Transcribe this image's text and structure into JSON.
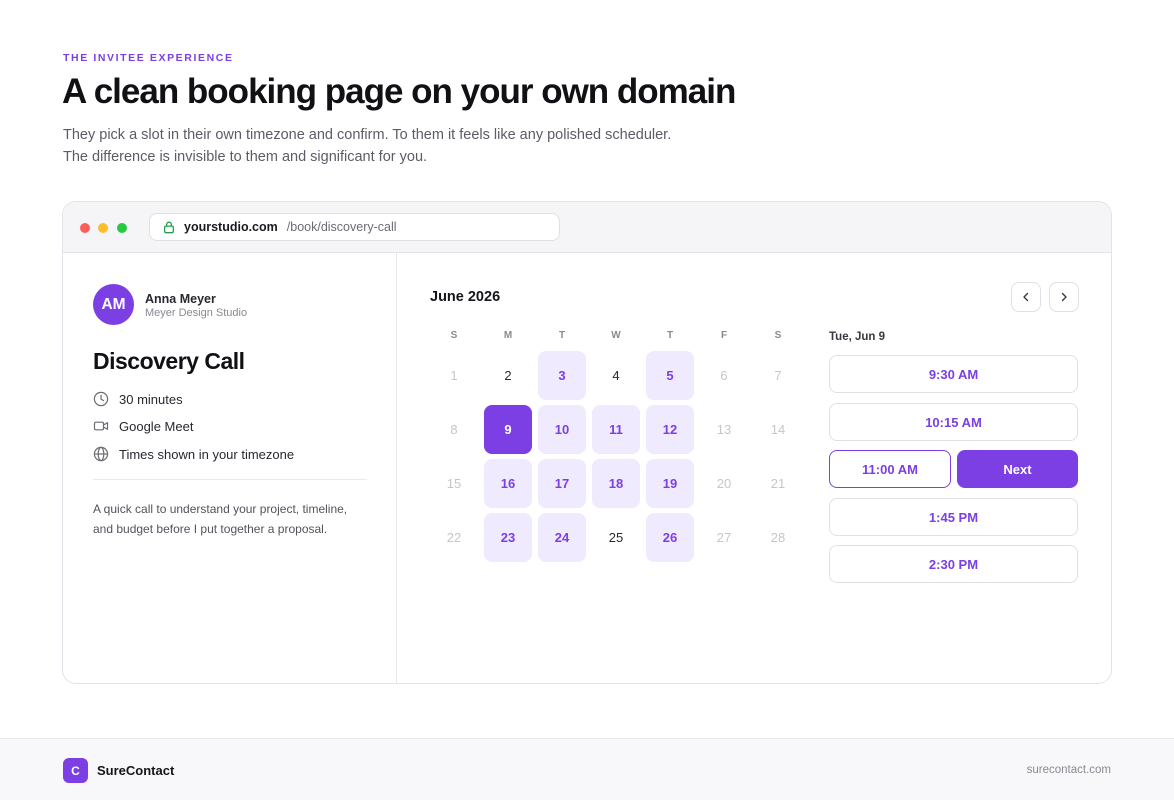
{
  "header": {
    "eyebrow": "THE INVITEE EXPERIENCE",
    "title": "A clean booking page on your own domain",
    "subtitle_line1": "They pick a slot in their own timezone and confirm. To them it feels like any polished scheduler.",
    "subtitle_line2": "The difference is invisible to them and significant for you."
  },
  "browser": {
    "domain": "yourstudio.com",
    "path": "/book/discovery-call"
  },
  "host": {
    "initials": "AM",
    "name": "Anna Meyer",
    "studio": "Meyer Design Studio"
  },
  "event": {
    "title": "Discovery Call",
    "duration": "30 minutes",
    "location": "Google Meet",
    "timezone_note": "Times shown in your timezone",
    "description": "A quick call to understand your project, timeline, and budget before I put together a proposal."
  },
  "calendar": {
    "month_label": "June 2026",
    "weekdays": [
      "S",
      "M",
      "T",
      "W",
      "T",
      "F",
      "S"
    ],
    "weeks": [
      [
        {
          "d": "1",
          "s": "muted"
        },
        {
          "d": "2",
          "s": "plain"
        },
        {
          "d": "3",
          "s": "avail"
        },
        {
          "d": "4",
          "s": "plain"
        },
        {
          "d": "5",
          "s": "avail"
        },
        {
          "d": "6",
          "s": "muted"
        },
        {
          "d": "7",
          "s": "muted"
        }
      ],
      [
        {
          "d": "8",
          "s": "muted"
        },
        {
          "d": "9",
          "s": "sel"
        },
        {
          "d": "10",
          "s": "avail"
        },
        {
          "d": "11",
          "s": "avail"
        },
        {
          "d": "12",
          "s": "avail"
        },
        {
          "d": "13",
          "s": "muted"
        },
        {
          "d": "14",
          "s": "muted"
        }
      ],
      [
        {
          "d": "15",
          "s": "muted"
        },
        {
          "d": "16",
          "s": "avail"
        },
        {
          "d": "17",
          "s": "avail"
        },
        {
          "d": "18",
          "s": "avail"
        },
        {
          "d": "19",
          "s": "avail"
        },
        {
          "d": "20",
          "s": "muted"
        },
        {
          "d": "21",
          "s": "muted"
        }
      ],
      [
        {
          "d": "22",
          "s": "muted"
        },
        {
          "d": "23",
          "s": "avail"
        },
        {
          "d": "24",
          "s": "avail"
        },
        {
          "d": "25",
          "s": "plain"
        },
        {
          "d": "26",
          "s": "avail"
        },
        {
          "d": "27",
          "s": "muted"
        },
        {
          "d": "28",
          "s": "muted"
        }
      ]
    ]
  },
  "times": {
    "date_label": "Tue, Jun 9",
    "slots": [
      "9:30 AM",
      "10:15 AM",
      "11:00 AM",
      "1:45 PM",
      "2:30 PM"
    ],
    "selected": "11:00 AM",
    "next_label": "Next"
  },
  "footer": {
    "logo_letter": "C",
    "brand": "SureContact",
    "url": "surecontact.com"
  },
  "colors": {
    "accent": "#7b3fe4",
    "accent_soft": "#efeafd"
  }
}
